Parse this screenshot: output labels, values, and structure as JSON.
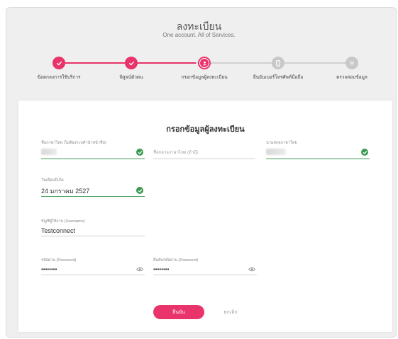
{
  "header": {
    "title": "ลงทะเบียน",
    "subtitle": "One account. All of Services."
  },
  "steps": [
    {
      "label": "ข้อตกลงการใช้บริการ",
      "status": "done",
      "icon": "check-icon"
    },
    {
      "label": "พิสูจน์ตัวตน",
      "status": "done",
      "icon": "check-icon"
    },
    {
      "label": "กรอกข้อมูลผู้ลงทะเบียน",
      "status": "current",
      "icon": "user-icon"
    },
    {
      "label": "ยืนยันเบอร์โทรศัพท์มือถือ",
      "status": "todo",
      "icon": "phone-icon"
    },
    {
      "label": "ตรวจสอบข้อมูล",
      "status": "todo",
      "icon": "list-icon"
    }
  ],
  "form": {
    "title": "กรอกข้อมูลผู้ลงทะเบียน",
    "first_name": {
      "label": "ชื่อภาษาไทย (ไม่ต้องระบุคำนำหน้าชื่อ)",
      "value": ""
    },
    "middle_name": {
      "label": "",
      "placeholder": "ชื่อกลางภาษาไทย (ถ้ามี)",
      "value": ""
    },
    "last_name": {
      "label": "นามสกุลภาษาไทย",
      "value": ""
    },
    "birthdate": {
      "label": "วันเดือนปีเกิด",
      "value": "24 มกราคม 2527"
    },
    "username": {
      "label": "บัญชีผู้ใช้งาน (Username)",
      "value": "Testconnect"
    },
    "password": {
      "label": "รหัสผ่าน (Password)",
      "value": "••••••••"
    },
    "confirm_password": {
      "label": "ยืนยันรหัสผ่าน (Password)",
      "value": "••••••••"
    }
  },
  "buttons": {
    "confirm": "ยืนยัน",
    "cancel": "ยกเลิก"
  },
  "colors": {
    "accent": "#e8336b",
    "success": "#3a9a52",
    "inactive": "#c8c8c8"
  }
}
